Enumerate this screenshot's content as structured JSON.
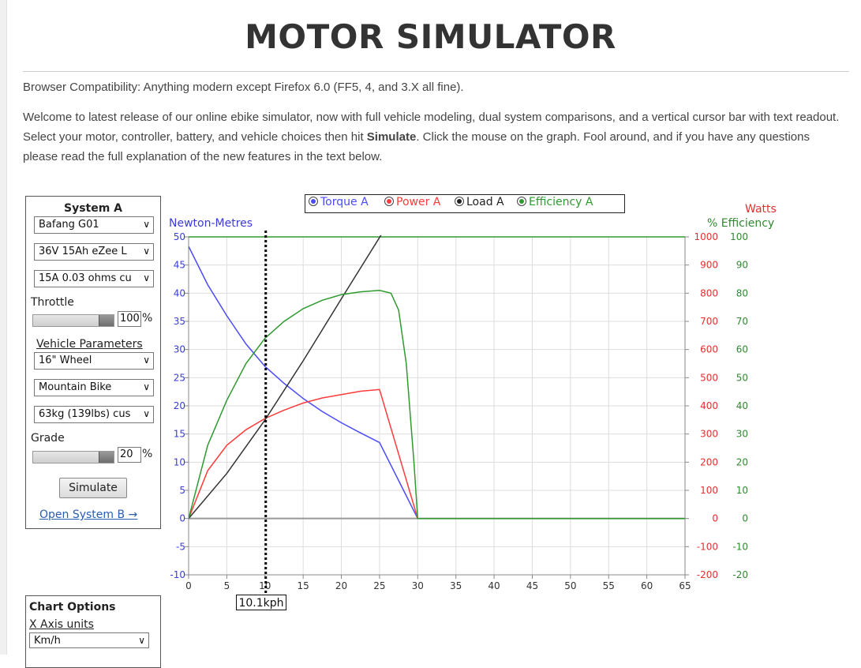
{
  "page": {
    "title": "MOTOR SIMULATOR",
    "compat": "Browser Compatibility: Anything modern except Firefox 6.0 (FF5, 4, and 3.X all fine).",
    "intro_a": "Welcome to latest release of our online ebike simulator, now with full vehicle modeling, dual system comparisons, and a vertical cursor bar with text readout. Select your motor, controller, battery, and vehicle choices then hit ",
    "intro_bold": "Simulate",
    "intro_b": ". Click the mouse on the graph. Fool around, and if you have any questions please read the full explanation of the new features in the text below."
  },
  "system": {
    "title": "System A",
    "motor": "Bafang G01",
    "battery": "36V 15Ah eZee L",
    "controller": "15A 0.03 ohms cu",
    "throttle_label": "Throttle",
    "throttle_value": "100",
    "throttle_level": 1.0,
    "vehicle_label": "Vehicle Parameters",
    "wheel": "16\"  Wheel",
    "bike": "Mountain Bike",
    "rider": "63kg (139lbs) cus",
    "grade_label": "Grade",
    "grade_value": "20",
    "grade_level": 1.0,
    "pct": "%",
    "simulate": "Simulate",
    "open_b": "Open System B →"
  },
  "chart_options": {
    "title": "Chart Options",
    "x_axis_label": "X Axis units",
    "x_axis_value": "Km/h"
  },
  "legend": {
    "torque": "Torque A",
    "power": "Power A",
    "load": "Load A",
    "efficiency": "Efficiency A"
  },
  "colors": {
    "torque": "#4b4bff",
    "power": "#ff3b3b",
    "load": "#333333",
    "efficiency": "#2f9a2f",
    "grid": "#dddddd"
  },
  "cursor": {
    "x": 10.1,
    "label": "10.1kph"
  },
  "chart_data": {
    "type": "line",
    "xlabel": "",
    "ylabel_left": "Newton-Metres",
    "ylabel_right_1": "Watts",
    "ylabel_right_2": "% Efficiency",
    "xlim": [
      0,
      65
    ],
    "ylim_left": [
      -10,
      50
    ],
    "ylim_watts": [
      -200,
      1000
    ],
    "ylim_eff": [
      -20,
      100
    ],
    "x_ticks": [
      0,
      5,
      10,
      15,
      20,
      25,
      30,
      35,
      40,
      45,
      50,
      55,
      60,
      65
    ],
    "y_left_ticks": [
      -10,
      -5,
      0,
      5,
      10,
      15,
      20,
      25,
      30,
      35,
      40,
      45,
      50
    ],
    "y_watts_ticks": [
      -200,
      -100,
      0,
      100,
      200,
      300,
      400,
      500,
      600,
      700,
      800,
      900,
      1000
    ],
    "y_eff_ticks": [
      -20,
      -10,
      0,
      10,
      20,
      30,
      40,
      50,
      60,
      70,
      80,
      90,
      100
    ],
    "series": [
      {
        "key": "torque",
        "name": "Torque A",
        "axis": "left",
        "x": [
          0,
          2.5,
          5,
          7.5,
          10,
          12.5,
          15,
          17.5,
          20,
          22.5,
          25,
          30,
          65
        ],
        "y": [
          48.3,
          41.5,
          36.0,
          31.0,
          27.0,
          24.0,
          21.3,
          19.0,
          17.0,
          15.2,
          13.5,
          0,
          0
        ]
      },
      {
        "key": "power",
        "name": "Power A",
        "axis": "watts",
        "x": [
          0,
          2.5,
          5,
          7.5,
          10,
          12.5,
          15,
          17.5,
          20,
          22.5,
          25,
          30,
          65
        ],
        "y": [
          0,
          170,
          260,
          315,
          355,
          385,
          410,
          428,
          440,
          452,
          458,
          0,
          0
        ]
      },
      {
        "key": "load",
        "name": "Load A",
        "axis": "left",
        "x": [
          0,
          5,
          10,
          15,
          20,
          25.5
        ],
        "y": [
          0,
          8.0,
          17.5,
          28.0,
          39.0,
          51.0
        ]
      },
      {
        "key": "efficiency",
        "name": "Efficiency A",
        "axis": "eff",
        "x": [
          0,
          2.5,
          5,
          7.5,
          10,
          12.5,
          15,
          17.5,
          20,
          22.5,
          25,
          26.5,
          27.5,
          28.5,
          29.5,
          30,
          65
        ],
        "y": [
          0,
          26,
          42,
          55,
          64,
          70,
          74.5,
          77.5,
          79.5,
          80.5,
          81,
          80,
          74,
          55,
          20,
          0,
          0
        ]
      }
    ]
  }
}
